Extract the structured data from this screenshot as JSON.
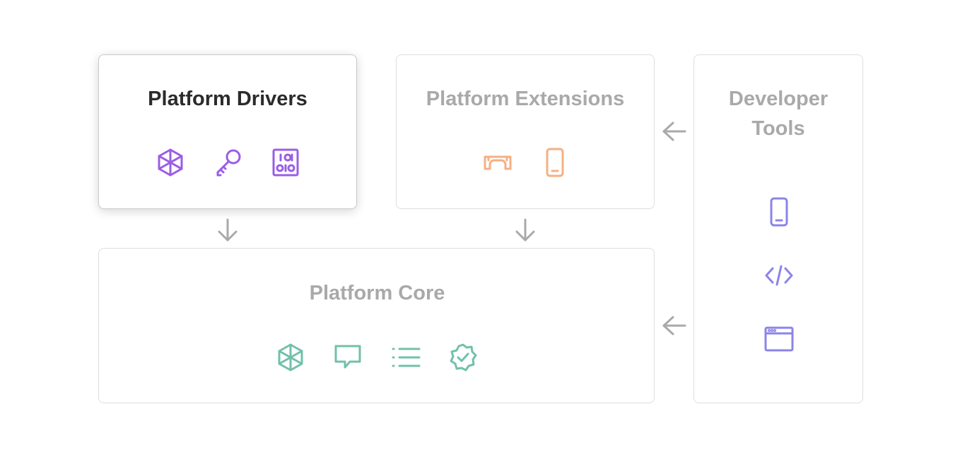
{
  "diagram": {
    "boxes": {
      "drivers": {
        "title": "Platform Drivers",
        "highlighted": true
      },
      "extensions": {
        "title": "Platform Extensions",
        "highlighted": false
      },
      "tools": {
        "title_line1": "Developer",
        "title_line2": "Tools",
        "highlighted": false
      },
      "core": {
        "title": "Platform Core",
        "highlighted": false
      }
    },
    "icons": {
      "drivers": [
        "hexagon-cube-icon",
        "key-icon",
        "control-panel-icon"
      ],
      "extensions": [
        "bridge-icon",
        "phone-icon"
      ],
      "tools": [
        "phone-icon",
        "code-icon",
        "browser-window-icon"
      ],
      "core": [
        "hexagon-cube-icon",
        "chat-bubble-icon",
        "list-icon",
        "verified-badge-icon"
      ]
    },
    "arrows": [
      {
        "from": "drivers",
        "to": "core",
        "direction": "down"
      },
      {
        "from": "extensions",
        "to": "core",
        "direction": "down"
      },
      {
        "from": "tools",
        "to": "extensions",
        "direction": "left"
      },
      {
        "from": "tools",
        "to": "core",
        "direction": "left"
      }
    ],
    "colors": {
      "drivers_icons": "#9b5de5",
      "extensions_icons": "#f5b083",
      "tools_icons": "#8b84e8",
      "core_icons": "#72c0aa",
      "arrows": "#a9a9a9",
      "active_title": "#2b2b2b",
      "inactive_title": "#a9a9a9",
      "border": "#dedede"
    }
  }
}
